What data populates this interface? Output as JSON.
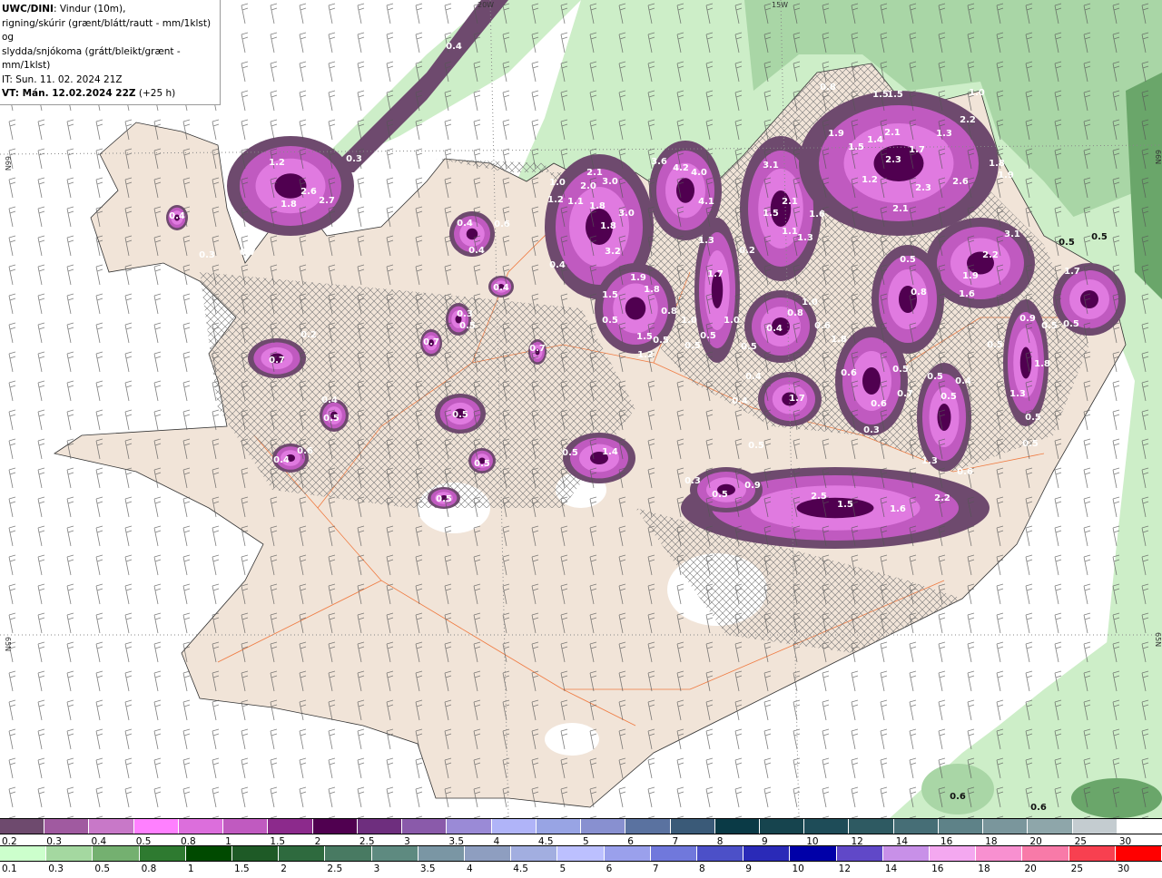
{
  "header": {
    "model": "UWC/DINI",
    "line1_rest": ": Vindur (10m),",
    "line2": "rigning/skúrir (grænt/blátt/rautt - mm/1klst) og",
    "line3": "slydda/snjókoma (grátt/bleikt/grænt - mm/1klst)",
    "issue_time": "IT: Sun. 11. 02. 2024 21Z",
    "valid_label": "VT: Mán. 12.02.2024 22Z",
    "lead_time": "(+25 h)"
  },
  "map": {
    "region": "Iceland",
    "colors": {
      "sea": "#ffffff",
      "land": "#f1e4d8",
      "roads": "#f07a40",
      "green_light": "#cdeec8",
      "green_mid": "#a9d6a6",
      "green_dark": "#6aa66a",
      "purple_outer": "#6e4a6e",
      "purple_mid": "#c05ac0",
      "purple_bright": "#e07ae0",
      "purple_core": "#500050"
    },
    "grid_labels": [
      "20W",
      "15W",
      "66N",
      "66N",
      "65N",
      "65N"
    ],
    "wind_barb_icon": "wind-barb-icon",
    "hatching": "cross-hatch (sleet/snow mix)",
    "value_labels": [
      "0.4",
      "0.9",
      "1.2",
      "2.6",
      "2.7",
      "1.8",
      "0.4",
      "0.7",
      "0.3",
      "0.3",
      "0.4",
      "0.6",
      "0.4",
      "0.4",
      "0.3",
      "0.5",
      "0.7",
      "0.7",
      "0.5",
      "0.5",
      "0.5",
      "0.4",
      "0.5",
      "0.2",
      "0.7",
      "0.6",
      "0.4",
      "0.5",
      "1.4",
      "1.0",
      "2.1",
      "2.0",
      "3.0",
      "1.2",
      "1.1",
      "1.8",
      "3.0",
      "1.8",
      "3.2",
      "0.4",
      "1.9",
      "1.8",
      "1.5",
      "0.5",
      "1.5",
      "1.2",
      "0.8",
      "0.5",
      "3.6",
      "4.2",
      "4.0",
      "4.1",
      "1.3",
      "1.7",
      "1.0",
      "1.0",
      "0.5",
      "0.5",
      "3.1",
      "2.1",
      "1.5",
      "1.6",
      "1.1",
      "1.3",
      "0.2",
      "0.4",
      "0.8",
      "1.0",
      "0.6",
      "0.5",
      "0.4",
      "0.4",
      "1.7",
      "0.5",
      "0.8",
      "1.5",
      "1.5",
      "1.0",
      "2.2",
      "1.9",
      "1.3",
      "1.5",
      "1.4",
      "2.1",
      "1.7",
      "2.3",
      "2.3",
      "2.6",
      "1.2",
      "2.1",
      "1.8",
      "1.9",
      "3.1",
      "2.2",
      "0.5",
      "0.5",
      "0.5",
      "1.9",
      "1.6",
      "0.8",
      "1.7",
      "0.9",
      "0.5",
      "0.5",
      "0.5",
      "1.8",
      "0.6",
      "0.5",
      "0.7",
      "0.6",
      "0.5",
      "0.4",
      "0.5",
      "1.3",
      "0.5",
      "0.3",
      "0.5",
      "1.3",
      "0.6",
      "1.8",
      "0.3",
      "0.9",
      "0.5",
      "2.5",
      "1.5",
      "1.6",
      "2.2",
      "0.6",
      "0.6"
    ]
  },
  "legend_snow": {
    "labels": [
      "0.2",
      "0.3",
      "0.4",
      "0.5",
      "0.8",
      "1",
      "1.5",
      "2",
      "2.5",
      "3",
      "3.5",
      "4",
      "4.5",
      "5",
      "6",
      "7",
      "8",
      "9",
      "10",
      "12",
      "14",
      "16",
      "18",
      "20",
      "25",
      "30"
    ],
    "colors": [
      "#6e4a6e",
      "#a05aa0",
      "#c878c8",
      "#ff80ff",
      "#dc6edc",
      "#c05ac0",
      "#8c2a8c",
      "#500050",
      "#6e2e7e",
      "#8a5aaa",
      "#9a8ad6",
      "#b0b4f8",
      "#98a4e4",
      "#8890d0",
      "#5a72a0",
      "#3a5a78",
      "#0a3a46",
      "#16444e",
      "#1e4c58",
      "#2e5a62",
      "#466e76",
      "#5e8288",
      "#7a969c",
      "#8ea6aa",
      "#c4ccd0",
      "#ffffff"
    ]
  },
  "legend_rain": {
    "labels": [
      "0.1",
      "0.3",
      "0.5",
      "0.8",
      "1",
      "1.5",
      "2",
      "2.5",
      "3",
      "3.5",
      "4",
      "4.5",
      "5",
      "6",
      "7",
      "8",
      "9",
      "10",
      "12",
      "14",
      "16",
      "18",
      "20",
      "25",
      "30"
    ],
    "colors": [
      "#ccffcc",
      "#a4d8a0",
      "#74b070",
      "#2e7a30",
      "#004a00",
      "#1e5a26",
      "#2e6a3e",
      "#487a62",
      "#5e8a80",
      "#7a96a4",
      "#8e9ec0",
      "#a2aee0",
      "#bcc0ff",
      "#9aa0ec",
      "#7078dc",
      "#4c50c8",
      "#2a2ab8",
      "#0000a8",
      "#6048c8",
      "#c890e8",
      "#f4a8f0",
      "#f890d0",
      "#f87aa8",
      "#f84050",
      "#ff0000"
    ]
  }
}
